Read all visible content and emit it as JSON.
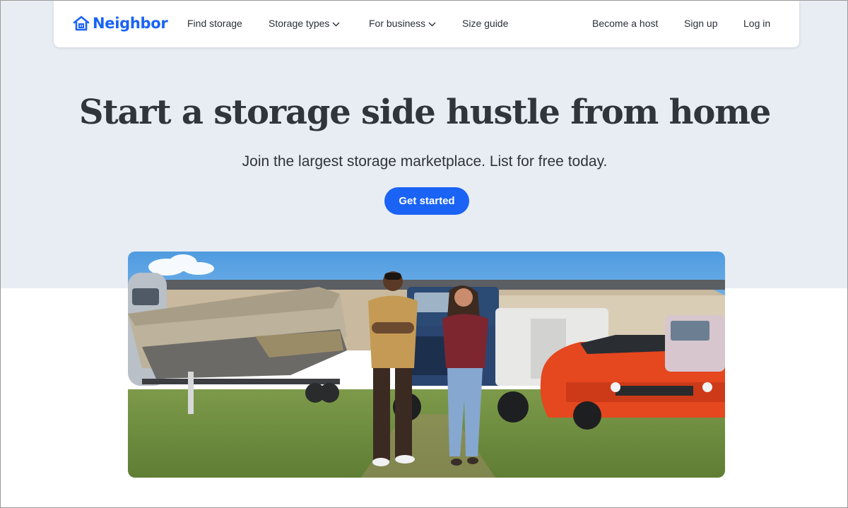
{
  "brand": {
    "name": "Neighbor",
    "color": "#1a63f5",
    "logo_icon": "house-icon"
  },
  "nav": {
    "links": [
      {
        "label": "Find storage",
        "has_dropdown": false
      },
      {
        "label": "Storage types",
        "has_dropdown": true
      },
      {
        "label": "For business",
        "has_dropdown": true
      },
      {
        "label": "Size guide",
        "has_dropdown": false
      }
    ],
    "right": [
      {
        "label": "Become a host"
      },
      {
        "label": "Sign up"
      },
      {
        "label": "Log in"
      }
    ]
  },
  "hero": {
    "headline": "Start a storage side hustle from home",
    "subheadline": "Join the largest storage marketplace. List for free today.",
    "cta_label": "Get started",
    "background_color": "#e8edf4"
  },
  "photo": {
    "subject": "two hosts standing in a yard with a covered boat, a blue truck, a white trailer and an orange sports car"
  }
}
